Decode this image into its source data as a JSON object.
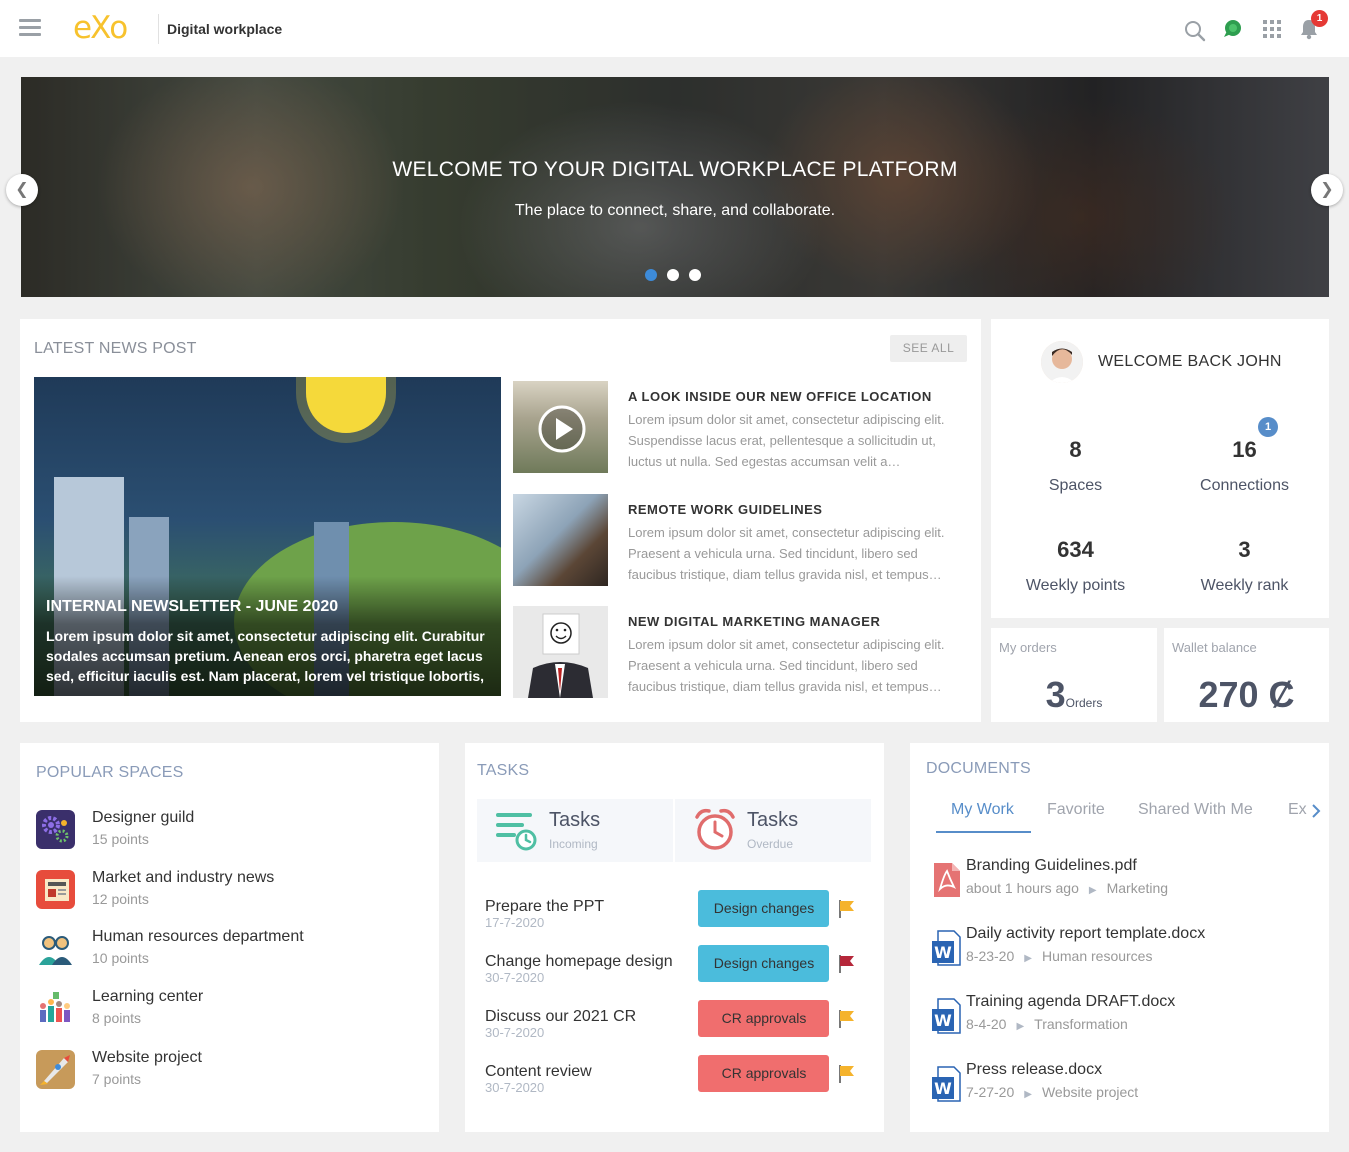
{
  "header": {
    "logo": "eXo",
    "app_name": "Digital workplace",
    "notification_count": "1",
    "icons": [
      "menu-icon",
      "search-icon",
      "chat-icon",
      "apps-grid-icon",
      "bell-icon"
    ]
  },
  "banner": {
    "title": "WELCOME TO YOUR DIGITAL WORKPLACE PLATFORM",
    "subtitle": "The place to connect, share, and collaborate.",
    "prev": "❮",
    "next": "❯",
    "slides_count": 3,
    "active_slide": 1
  },
  "news": {
    "section_title": "LATEST NEWS POST",
    "see_all": "SEE ALL",
    "featured": {
      "title": "INTERNAL NEWSLETTER - JUNE 2020",
      "excerpt": "Lorem ipsum dolor sit amet, consectetur adipiscing elit. Curabitur sodales accumsan pretium. Aenean eros orci, pharetra eget lacus sed, efficitur iaculis est. Nam placerat, lorem vel tristique lobortis, lorem velit commodo"
    },
    "items": [
      {
        "title": "A LOOK INSIDE OUR NEW OFFICE LOCATION",
        "excerpt": "Lorem ipsum dolor sit amet, consectetur adipiscing elit. Suspendisse lacus erat, pellentesque a sollicitudin ut, luctus ut nulla. Sed egestas accumsan velit a…"
      },
      {
        "title": "REMOTE WORK GUIDELINES",
        "excerpt": "Lorem ipsum dolor sit amet, consectetur adipiscing elit. Praesent a vehicula urna. Sed tincidunt, libero sed faucibus tristique, diam tellus gravida nisl, et tempus…"
      },
      {
        "title": "NEW DIGITAL MARKETING MANAGER",
        "excerpt": "Lorem ipsum dolor sit amet, consectetur adipiscing elit. Praesent a vehicula urna. Sed tincidunt, libero sed faucibus tristique, diam tellus gravida nisl, et tempus…"
      }
    ]
  },
  "profile": {
    "welcome": "WELCOME BACK JOHN",
    "connections_badge": "1",
    "stats": [
      {
        "value": "8",
        "label": "Spaces"
      },
      {
        "value": "16",
        "label": "Connections"
      },
      {
        "value": "634",
        "label": "Weekly points"
      },
      {
        "value": "3",
        "label": "Weekly rank"
      }
    ]
  },
  "orders": {
    "label": "My orders",
    "value": "3",
    "unit": "Orders"
  },
  "wallet": {
    "label": "Wallet balance",
    "value": "270 Ȼ"
  },
  "spaces": {
    "section_title": "POPULAR SPACES",
    "items": [
      {
        "name": "Designer guild",
        "points": "15 points"
      },
      {
        "name": "Market and industry news",
        "points": "12 points"
      },
      {
        "name": "Human resources department",
        "points": "10 points"
      },
      {
        "name": "Learning center",
        "points": "8 points"
      },
      {
        "name": "Website project",
        "points": "7 points"
      }
    ]
  },
  "tasks": {
    "section_title": "TASKS",
    "tabs": [
      {
        "title": "Tasks",
        "subtitle": "Incoming"
      },
      {
        "title": "Tasks",
        "subtitle": "Overdue"
      }
    ],
    "items": [
      {
        "name": "Prepare the PPT",
        "date": "17-7-2020",
        "label": "Design changes",
        "label_color": "#4bbcdc",
        "flag_color": "#f5b32c"
      },
      {
        "name": "Change homepage design",
        "date": "30-7-2020",
        "label": "Design changes",
        "label_color": "#4bbcdc",
        "flag_color": "#b5273a"
      },
      {
        "name": "Discuss our 2021 CR",
        "date": "30-7-2020",
        "label": "CR approvals",
        "label_color": "#f06e6e",
        "flag_color": "#f5b32c"
      },
      {
        "name": "Content review",
        "date": "30-7-2020",
        "label": "CR approvals",
        "label_color": "#f06e6e",
        "flag_color": "#f5b32c"
      }
    ]
  },
  "documents": {
    "section_title": "DOCUMENTS",
    "tabs": [
      "My Work",
      "Favorite",
      "Shared With Me",
      "Ex"
    ],
    "items": [
      {
        "name": "Branding Guidelines.pdf",
        "date": "about 1 hours ago",
        "folder": "Marketing",
        "type": "pdf"
      },
      {
        "name": "Daily activity report template.docx",
        "date": "8-23-20",
        "folder": "Human resources",
        "type": "word"
      },
      {
        "name": "Training agenda DRAFT.docx",
        "date": "8-4-20",
        "folder": "Transformation",
        "type": "word"
      },
      {
        "name": "Press release.docx",
        "date": "7-27-20",
        "folder": "Website project",
        "type": "word"
      }
    ]
  },
  "colors": {
    "accent_blue": "#578dc9",
    "logo_yellow": "#f7c22d",
    "task_blue": "#4bbcdc",
    "task_red": "#f06e6e"
  }
}
